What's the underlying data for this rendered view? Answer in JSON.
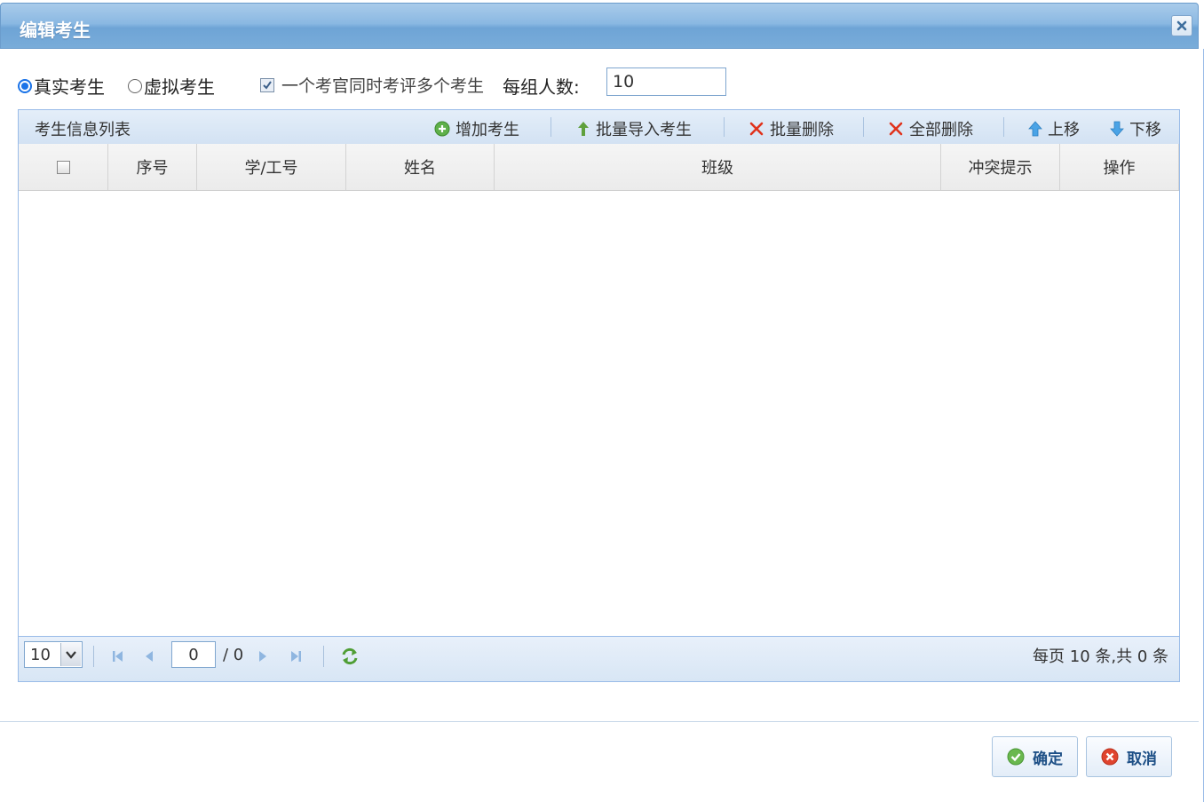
{
  "dialog": {
    "title": "编辑考生"
  },
  "options": {
    "radio_real": "真实考生",
    "radio_virtual": "虚拟考生",
    "multi_checkbox_label": "一个考官同时考评多个考生",
    "group_size_label": "每组人数:",
    "group_size_value": "10"
  },
  "grid": {
    "caption": "考生信息列表",
    "toolbar": {
      "add": "增加考生",
      "import": "批量导入考生",
      "batch_delete": "批量删除",
      "delete_all": "全部删除",
      "move_up": "上移",
      "move_down": "下移"
    },
    "columns": [
      "序号",
      "学/工号",
      "姓名",
      "班级",
      "冲突提示",
      "操作"
    ],
    "rows": []
  },
  "pager": {
    "page_size": "10",
    "current_page": "0",
    "total_pages": "/ 0",
    "info": "每页 10 条,共 0 条"
  },
  "footer": {
    "ok": "确定",
    "cancel": "取消"
  },
  "colors": {
    "title_bar": "#8ab8e2",
    "border": "#99bbe8",
    "button_text": "#1d4f86"
  }
}
